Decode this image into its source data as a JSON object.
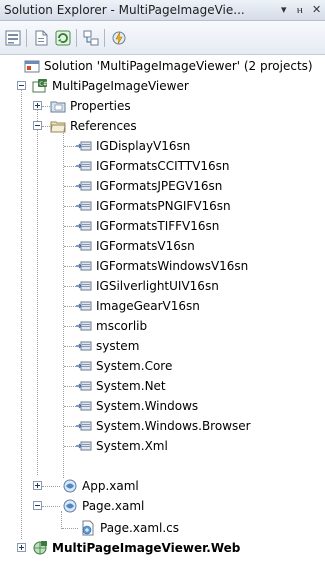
{
  "window": {
    "title": "Solution Explorer - MultiPageImageVie...",
    "dropdown_glyph": "▾",
    "pin_glyph": "ⲏ",
    "close_glyph": "✕"
  },
  "toolbar": {
    "buttons": [
      "properties-icon",
      "show-all-files-icon",
      "refresh-icon",
      "view-class-diagram-icon",
      "lightning-icon"
    ]
  },
  "tree": {
    "solution": "Solution 'MultiPageImageViewer' (2 projects)",
    "project": "MultiPageImageViewer",
    "properties": "Properties",
    "references": "References",
    "reference_items": [
      "IGDisplayV16sn",
      "IGFormatsCCITTV16sn",
      "IGFormatsJPEGV16sn",
      "IGFormatsPNGIFV16sn",
      "IGFormatsTIFFV16sn",
      "IGFormatsV16sn",
      "IGFormatsWindowsV16sn",
      "IGSilverlightUIV16sn",
      "ImageGearV16sn",
      "mscorlib",
      "system",
      "System.Core",
      "System.Net",
      "System.Windows",
      "System.Windows.Browser",
      "System.Xml"
    ],
    "app_xaml": "App.xaml",
    "page_xaml": "Page.xaml",
    "page_xaml_cs": "Page.xaml.cs",
    "web_project": "MultiPageImageViewer.Web"
  },
  "colors": {
    "accent": "#1e3a6a",
    "folder": "#e6c35a"
  }
}
